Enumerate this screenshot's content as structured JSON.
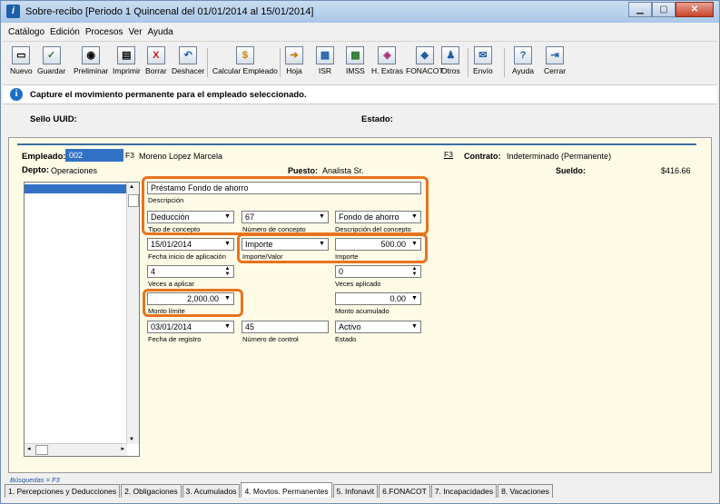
{
  "window": {
    "title": "Sobre-recibo  [Periodo 1 Quincenal del 01/01/2014 al 15/01/2014]",
    "app_icon": "i"
  },
  "menu": [
    "Catálogo",
    "Edición",
    "Procesos",
    "Ver",
    "Ayuda"
  ],
  "toolbar": [
    {
      "label": "Nuevo",
      "icon": "new-doc-icon",
      "glyph": "▭"
    },
    {
      "label": "Guardar",
      "icon": "check-icon",
      "glyph": "✓"
    },
    {
      "label": "Preliminar",
      "icon": "preview-icon",
      "glyph": "◉"
    },
    {
      "label": "Imprimir",
      "icon": "printer-icon",
      "glyph": "▤"
    },
    {
      "label": "Borrar",
      "icon": "delete-x-icon",
      "glyph": "X"
    },
    {
      "label": "Deshacer",
      "icon": "undo-icon",
      "glyph": "↶"
    },
    {
      "label": "Calcular Empleado",
      "icon": "calculate-icon",
      "glyph": "$"
    },
    {
      "label": "Hoja",
      "icon": "sheet-icon",
      "glyph": "➔"
    },
    {
      "label": "ISR",
      "icon": "isr-icon",
      "glyph": "▦"
    },
    {
      "label": "IMSS",
      "icon": "imss-icon",
      "glyph": "▩"
    },
    {
      "label": "H. Extras",
      "icon": "overtime-icon",
      "glyph": "◈"
    },
    {
      "label": "FONACOT",
      "icon": "fonacot-icon",
      "glyph": "◆"
    },
    {
      "label": "Otros",
      "icon": "others-icon",
      "glyph": "♟"
    },
    {
      "label": "Envío",
      "icon": "send-icon",
      "glyph": "✉"
    },
    {
      "label": "Ayuda",
      "icon": "help-icon",
      "glyph": "?"
    },
    {
      "label": "Cerrar",
      "icon": "close-door-icon",
      "glyph": "⇥"
    }
  ],
  "info": {
    "message": "Capture el movimiento permanente para el empleado seleccionado."
  },
  "uuid": {
    "sello_label": "Sello UUID:",
    "estado_label": "Estado:"
  },
  "employee": {
    "label": "Empleado:",
    "number": "002",
    "f3": "F3",
    "name": "Moreno Lopez Marcela",
    "f3b": "F3",
    "contrato_label": "Contrato:",
    "contrato": "Indeterminado (Permanente)",
    "depto_label": "Depto:",
    "depto": "Operaciones",
    "puesto_label": "Puesto:",
    "puesto": "Analista Sr.",
    "sueldo_label": "Sueldo:",
    "sueldo": "$416.66"
  },
  "form": {
    "descripcion": {
      "value": "Préstamo Fondo de ahorro",
      "caption": "Descripción"
    },
    "tipo_concepto": {
      "value": "Deducción",
      "caption": "Tipo de concepto"
    },
    "numero_concepto": {
      "value": "67",
      "caption": "Número de concepto"
    },
    "descripcion_concepto": {
      "value": "Fondo de ahorro",
      "caption": "Descripción del concepto"
    },
    "fecha_inicio": {
      "value": "15/01/2014",
      "caption": "Fecha inicio de aplicación"
    },
    "importe_valor": {
      "value": "Importe",
      "caption": "Importe/Valor"
    },
    "importe": {
      "value": "500.00",
      "caption": "Importe"
    },
    "veces_aplicar": {
      "value": "4",
      "caption": "Veces a aplicar"
    },
    "veces_aplicado": {
      "value": "0",
      "caption": "Veces aplicado"
    },
    "monto_limite": {
      "value": "2,000.00",
      "caption": "Monto límite"
    },
    "monto_acumulado": {
      "value": "0.00",
      "caption": "Monto acumulado"
    },
    "fecha_registro": {
      "value": "03/01/2014",
      "caption": "Fecha de registro"
    },
    "numero_control": {
      "value": "45",
      "caption": "Número de control"
    },
    "estado": {
      "value": "Activo",
      "caption": "Estado"
    }
  },
  "footer": {
    "busquedas": "Búsquedas = F3"
  },
  "tabs": [
    "1. Percepciones y Deducciones",
    "2. Obligaciones",
    "3. Acumulados",
    "4. Movtos. Permanentes",
    "5. Infonavit",
    "6.FONACOT",
    "7. Incapacidades",
    "8. Vacaciones"
  ],
  "active_tab": "4. Movtos. Permanentes",
  "colors": {
    "highlight": "#e8731e",
    "selection": "#3172c6",
    "panel_bg": "#fdfbe6"
  }
}
